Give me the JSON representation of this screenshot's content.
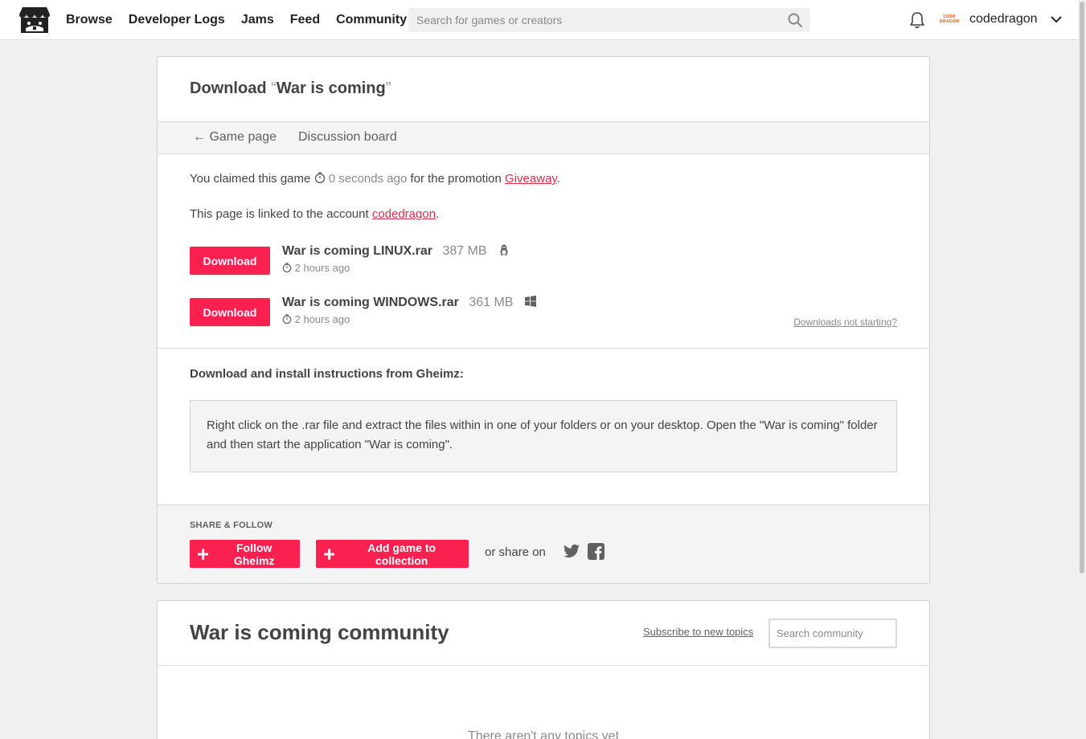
{
  "header": {
    "nav": [
      "Browse",
      "Developer Logs",
      "Jams",
      "Feed",
      "Community"
    ],
    "search_placeholder": "Search for games or creators",
    "avatar_text": "CODE DRAGON",
    "username": "codedragon"
  },
  "download": {
    "title_prefix": "Download",
    "open_quote": "“",
    "game_title": "War is coming",
    "close_quote": "”",
    "tabs": {
      "back_arrow": "←",
      "game_page": "Game page",
      "discussion": "Discussion board"
    },
    "claim": {
      "prefix": "You claimed this game",
      "time": "0 seconds ago",
      "middle": "for the promotion",
      "promotion": "Giveaway",
      "suffix": "."
    },
    "linked": {
      "prefix": "This page is linked to the account",
      "account": "codedragon",
      "suffix": "."
    },
    "download_label": "Download",
    "files": [
      {
        "name": "War is coming LINUX.rar",
        "size": "387 MB",
        "os_icon": "linux-icon",
        "date": "2 hours ago"
      },
      {
        "name": "War is coming WINDOWS.rar",
        "size": "361 MB",
        "os_icon": "windows-icon",
        "date": "2 hours ago"
      }
    ],
    "not_starting": "Downloads not starting?",
    "instructions_title": "Download and install instructions from Gheimz:",
    "instructions_text": "Right click on the .rar file and extract the files within in one of your folders or on your desktop. Open the \"War is coming\" folder and then start the application \"War is coming\"."
  },
  "share": {
    "label": "SHARE & FOLLOW",
    "follow_label": "Follow Gheimz",
    "collection_label": "Add game to collection",
    "or_share": "or share on",
    "icons": [
      "twitter-icon",
      "facebook-icon"
    ]
  },
  "community": {
    "title": "War is coming community",
    "subscribe": "Subscribe to new topics",
    "search_placeholder": "Search community",
    "empty": "There aren't any topics yet"
  },
  "colors": {
    "accent": "#fa2151",
    "link": "#da2c49",
    "background": "#f0f0f0"
  }
}
